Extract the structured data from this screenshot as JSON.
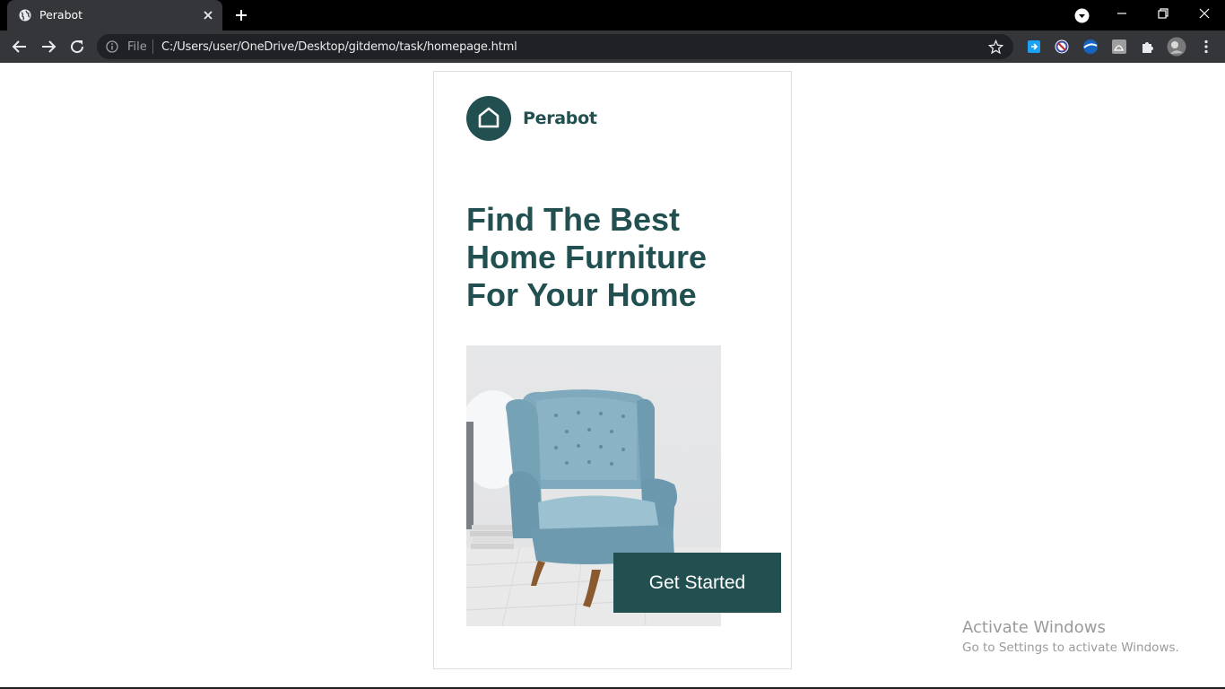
{
  "browser": {
    "tab": {
      "title": "Perabot"
    },
    "address": {
      "scheme_label": "File",
      "url": "C:/Users/user/OneDrive/Desktop/gitdemo/task/homepage.html"
    }
  },
  "page": {
    "brand": "Perabot",
    "headline": {
      "find": "Find ",
      "best": "The Best",
      "furniture": "Home Furniture",
      "for_home": "For Your Home"
    },
    "cta_label": "Get Started",
    "colors": {
      "primary": "#224f50",
      "chair": "#8ab4c6"
    }
  },
  "overlay": {
    "activate_title": "Activate Windows",
    "activate_sub": "Go to Settings to activate Windows."
  }
}
